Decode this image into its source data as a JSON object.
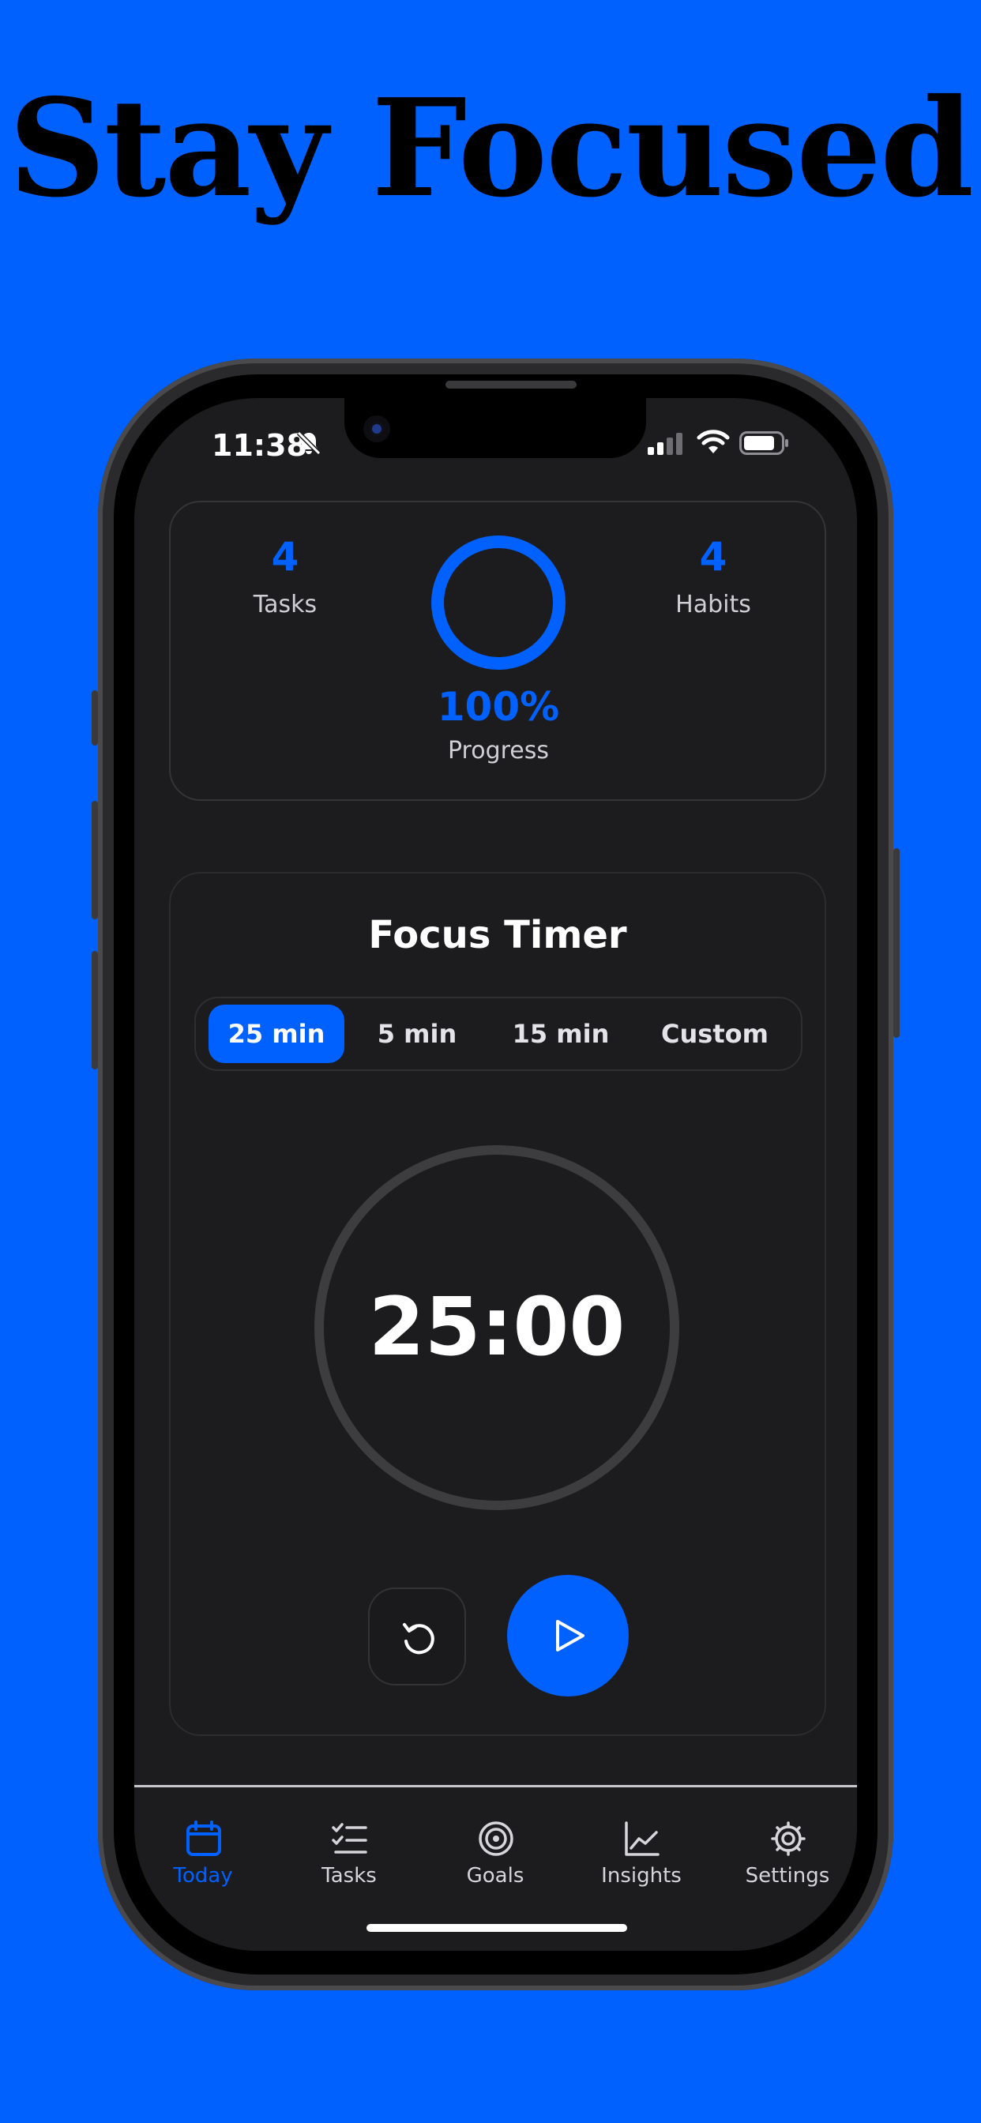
{
  "headline": "Stay Focused",
  "status_bar": {
    "time": "11:38"
  },
  "stats": {
    "tasks_count": "4",
    "tasks_label": "Tasks",
    "habits_count": "4",
    "habits_label": "Habits",
    "progress_percent": "100%",
    "progress_label": "Progress",
    "progress_value": 1.0
  },
  "focus_timer": {
    "title": "Focus Timer",
    "options": [
      "25 min",
      "5 min",
      "15 min",
      "Custom"
    ],
    "selected": "25 min",
    "time": "25:00"
  },
  "tabs": [
    {
      "label": "Today",
      "icon": "calendar-icon",
      "active": true
    },
    {
      "label": "Tasks",
      "icon": "checklist-icon",
      "active": false
    },
    {
      "label": "Goals",
      "icon": "target-icon",
      "active": false
    },
    {
      "label": "Insights",
      "icon": "chart-icon",
      "active": false
    },
    {
      "label": "Settings",
      "icon": "gear-icon",
      "active": false
    }
  ],
  "colors": {
    "accent": "#0061fe",
    "background": "#0061fe",
    "screen": "#1c1c1e"
  }
}
